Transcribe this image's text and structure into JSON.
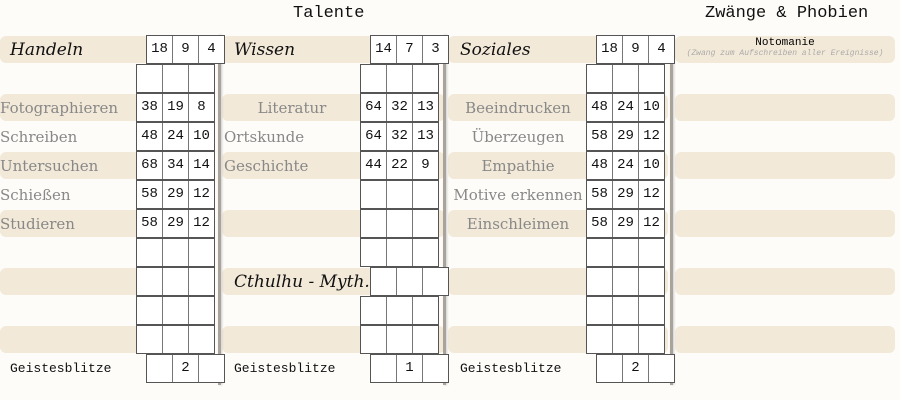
{
  "titles": {
    "talente": "Talente",
    "zwaenge": "Zwänge & Phobien"
  },
  "columns": [
    {
      "rows": [
        {
          "label": "Handeln",
          "head": true,
          "v": [
            "18",
            "9",
            "4"
          ]
        },
        {
          "label": "",
          "v": [
            "",
            "",
            ""
          ]
        },
        {
          "label": "Fotographieren",
          "v": [
            "38",
            "19",
            "8"
          ]
        },
        {
          "label": "Schreiben",
          "v": [
            "48",
            "24",
            "10"
          ]
        },
        {
          "label": "Untersuchen",
          "v": [
            "68",
            "34",
            "14"
          ]
        },
        {
          "label": "Schießen",
          "v": [
            "58",
            "29",
            "12"
          ]
        },
        {
          "label": "Studieren",
          "v": [
            "58",
            "29",
            "12"
          ]
        },
        {
          "label": "",
          "v": [
            "",
            "",
            ""
          ]
        },
        {
          "label": "",
          "v": [
            "",
            "",
            ""
          ]
        },
        {
          "label": "",
          "v": [
            "",
            "",
            ""
          ]
        },
        {
          "label": "",
          "v": [
            "",
            "",
            ""
          ]
        },
        {
          "label": "Geistesblitze",
          "gb": true,
          "v": [
            "",
            "2",
            ""
          ]
        }
      ]
    },
    {
      "rows": [
        {
          "label": "Wissen",
          "head": true,
          "v": [
            "14",
            "7",
            "3"
          ]
        },
        {
          "label": "",
          "v": [
            "",
            "",
            ""
          ]
        },
        {
          "label": "Literatur",
          "center": true,
          "v": [
            "64",
            "32",
            "13"
          ]
        },
        {
          "label": "Ortskunde",
          "v": [
            "64",
            "32",
            "13"
          ]
        },
        {
          "label": "Geschichte",
          "v": [
            "44",
            "22",
            "9"
          ]
        },
        {
          "label": "",
          "v": [
            "",
            "",
            ""
          ]
        },
        {
          "label": "",
          "v": [
            "",
            "",
            ""
          ]
        },
        {
          "label": "",
          "v": [
            "",
            "",
            ""
          ]
        },
        {
          "label": "Cthulhu - Myth.",
          "head": true,
          "v": [
            "",
            "",
            ""
          ]
        },
        {
          "label": "",
          "v": [
            "",
            "",
            ""
          ]
        },
        {
          "label": "",
          "v": [
            "",
            "",
            ""
          ]
        },
        {
          "label": "Geistesblitze",
          "gb": true,
          "v": [
            "",
            "1",
            ""
          ]
        }
      ]
    },
    {
      "rows": [
        {
          "label": "Soziales",
          "head": true,
          "v": [
            "18",
            "9",
            "4"
          ]
        },
        {
          "label": "",
          "v": [
            "",
            "",
            ""
          ]
        },
        {
          "label": "Beeindrucken",
          "center": true,
          "v": [
            "48",
            "24",
            "10"
          ]
        },
        {
          "label": "Überzeugen",
          "center": true,
          "v": [
            "58",
            "29",
            "12"
          ]
        },
        {
          "label": "Empathie",
          "center": true,
          "v": [
            "48",
            "24",
            "10"
          ]
        },
        {
          "label": "Motive erkennen",
          "center": true,
          "v": [
            "58",
            "29",
            "12"
          ]
        },
        {
          "label": "Einschleimen",
          "center": true,
          "v": [
            "58",
            "29",
            "12"
          ]
        },
        {
          "label": "",
          "v": [
            "",
            "",
            ""
          ]
        },
        {
          "label": "",
          "v": [
            "",
            "",
            ""
          ]
        },
        {
          "label": "",
          "v": [
            "",
            "",
            ""
          ]
        },
        {
          "label": "",
          "v": [
            "",
            "",
            ""
          ]
        },
        {
          "label": "Geistesblitze",
          "gb": true,
          "v": [
            "",
            "2",
            ""
          ]
        }
      ]
    }
  ],
  "phobia": {
    "name": "Notomanie",
    "desc": "(Zwang zum Aufschreiben aller Ereignisse)"
  }
}
